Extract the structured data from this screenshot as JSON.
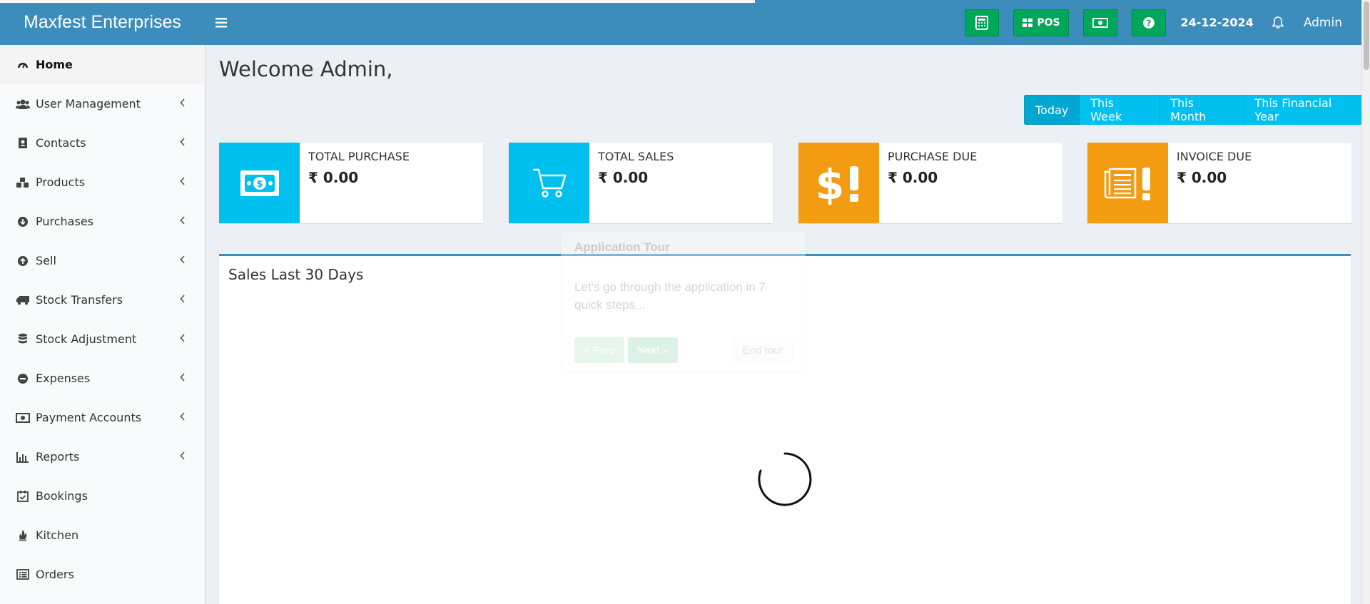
{
  "header": {
    "brand": "Maxfest Enterprises",
    "pos_label": "POS",
    "date": "24-12-2024",
    "user": "Admin",
    "icons": [
      "menu-icon",
      "calculator-icon",
      "pos-icon",
      "cash-icon",
      "help-icon",
      "bell-icon"
    ]
  },
  "sidebar": {
    "items": [
      {
        "label": "Home",
        "icon": "dashboard-icon",
        "active": true
      },
      {
        "label": "User Management",
        "icon": "users-icon"
      },
      {
        "label": "Contacts",
        "icon": "address-book-icon"
      },
      {
        "label": "Products",
        "icon": "cubes-icon"
      },
      {
        "label": "Purchases",
        "icon": "arrow-circle-down-icon"
      },
      {
        "label": "Sell",
        "icon": "arrow-circle-up-icon"
      },
      {
        "label": "Stock Transfers",
        "icon": "truck-icon"
      },
      {
        "label": "Stock Adjustment",
        "icon": "database-icon"
      },
      {
        "label": "Expenses",
        "icon": "minus-circle-icon"
      },
      {
        "label": "Payment Accounts",
        "icon": "money-icon"
      },
      {
        "label": "Reports",
        "icon": "bar-chart-icon"
      },
      {
        "label": "Bookings",
        "icon": "calendar-check-icon"
      },
      {
        "label": "Kitchen",
        "icon": "fire-icon"
      },
      {
        "label": "Orders",
        "icon": "list-alt-icon"
      }
    ]
  },
  "main": {
    "welcome": "Welcome Admin,",
    "filters": [
      "Today",
      "This Week",
      "This Month",
      "This Financial Year"
    ],
    "active_filter": "Today",
    "info_boxes": [
      {
        "label": "TOTAL PURCHASE",
        "value": "₹ 0.00",
        "color": "#00c0ef",
        "icon": "money-bill-icon"
      },
      {
        "label": "TOTAL SALES",
        "value": "₹ 0.00",
        "color": "#00c0ef",
        "icon": "shopping-cart-icon"
      },
      {
        "label": "PURCHASE DUE",
        "value": "₹ 0.00",
        "color": "#f39c12",
        "icon": "dollar-exclamation-icon"
      },
      {
        "label": "INVOICE DUE",
        "value": "₹ 0.00",
        "color": "#f39c12",
        "icon": "invoice-exclamation-icon"
      }
    ],
    "sales_title": "Sales Last 30 Days"
  },
  "tour": {
    "title": "Application Tour",
    "text": "Let's go through the application in 7 quick steps...",
    "prev": "« Prev",
    "next": "Next »",
    "end": "End tour"
  },
  "colors": {
    "header": "#3c8dbc",
    "aqua": "#00c0ef",
    "yellow": "#f39c12",
    "green": "#00a65a"
  }
}
